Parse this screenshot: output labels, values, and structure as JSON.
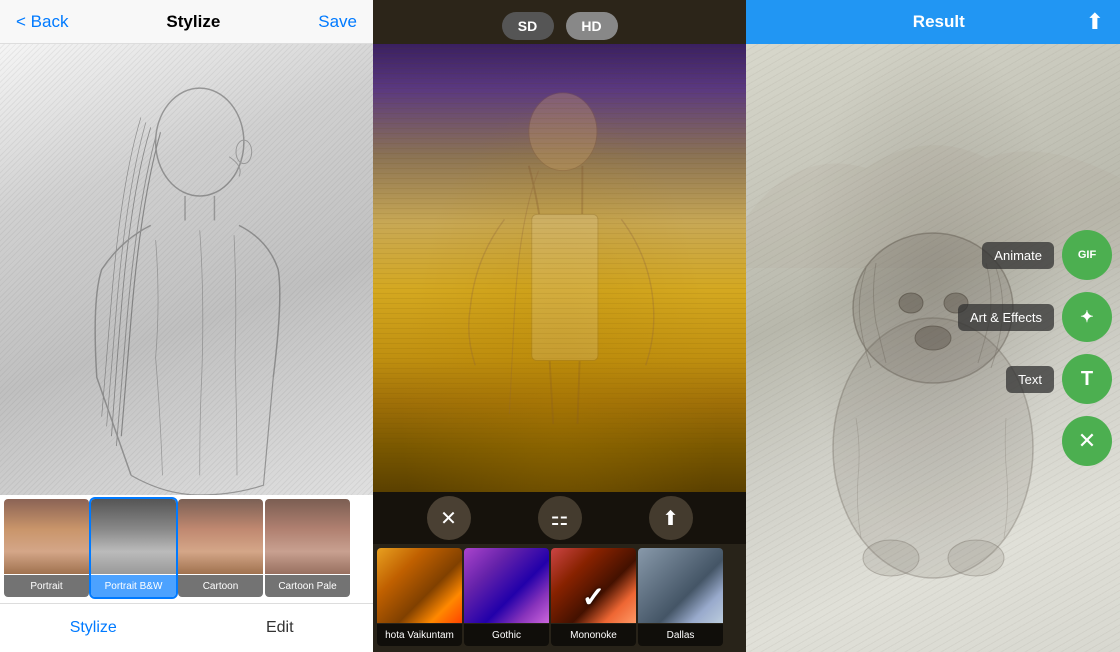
{
  "panel1": {
    "header": {
      "back_label": "< Back",
      "title": "Stylize",
      "save_label": "Save"
    },
    "thumbnails": [
      {
        "id": "portrait",
        "label": "Portrait",
        "active": false,
        "bg": "portrait1"
      },
      {
        "id": "portrait-bw",
        "label": "Portrait B&W",
        "active": true,
        "bg": "portrait2"
      },
      {
        "id": "cartoon",
        "label": "Cartoon",
        "active": false,
        "bg": "portrait3"
      },
      {
        "id": "cartoon-pale",
        "label": "Cartoon Pale",
        "active": false,
        "bg": "portrait4"
      }
    ],
    "bottom_tabs": [
      {
        "id": "stylize",
        "label": "Stylize",
        "active": true
      },
      {
        "id": "edit",
        "label": "Edit",
        "active": false
      }
    ]
  },
  "panel2": {
    "quality": {
      "sd_label": "SD",
      "hd_label": "HD"
    },
    "toolbar": {
      "close_icon": "✕",
      "settings_icon": "⚙",
      "share_icon": "↑"
    },
    "filters": [
      {
        "id": "bhota-vaikuntam",
        "label": "hota Vaikuntam",
        "active": false
      },
      {
        "id": "gothic",
        "label": "Gothic",
        "active": false
      },
      {
        "id": "mononoke",
        "label": "Mononoke",
        "active": true
      },
      {
        "id": "dallas",
        "label": "Dallas",
        "active": false
      }
    ]
  },
  "panel3": {
    "header": {
      "title": "Result",
      "share_icon": "⬆"
    },
    "actions": [
      {
        "id": "animate",
        "label": "Animate",
        "icon": "GIF"
      },
      {
        "id": "art-effects",
        "label": "Art & Effects",
        "icon": "✦"
      },
      {
        "id": "text",
        "label": "Text",
        "icon": "T"
      },
      {
        "id": "close",
        "label": "",
        "icon": "✕"
      }
    ]
  }
}
